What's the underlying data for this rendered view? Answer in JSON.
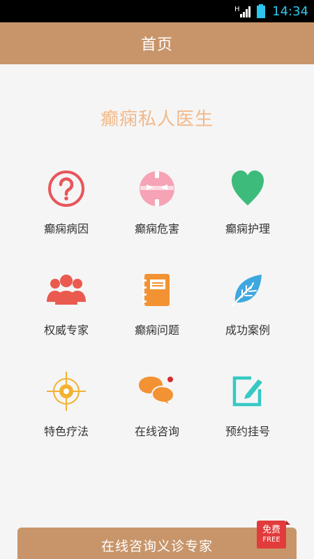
{
  "status_bar": {
    "time": "14:34",
    "network_label": "H"
  },
  "app_bar": {
    "title": "首页"
  },
  "headline": "癫痫私人医生",
  "grid": {
    "items": [
      {
        "label": "癫痫病因",
        "icon": "question-circle-icon",
        "color": "#e8555a"
      },
      {
        "label": "癫痫危害",
        "icon": "face-icon",
        "color": "#f5a3b5"
      },
      {
        "label": "癫痫护理",
        "icon": "heart-icon",
        "color": "#3dbb7a"
      },
      {
        "label": "权威专家",
        "icon": "experts-group-icon",
        "color": "#ea5a4e"
      },
      {
        "label": "癫痫问题",
        "icon": "notebook-icon",
        "color": "#f29233"
      },
      {
        "label": "成功案例",
        "icon": "leaf-icon",
        "color": "#3ea7df"
      },
      {
        "label": "特色疗法",
        "icon": "target-icon",
        "color": "#f2b233"
      },
      {
        "label": "在线咨询",
        "icon": "chat-bubbles-icon",
        "color": "#f29233"
      },
      {
        "label": "预约挂号",
        "icon": "edit-icon",
        "color": "#35c9c4"
      }
    ]
  },
  "cta": {
    "label": "在线咨询义诊专家",
    "badge_zh": "免费",
    "badge_en": "FREE"
  }
}
